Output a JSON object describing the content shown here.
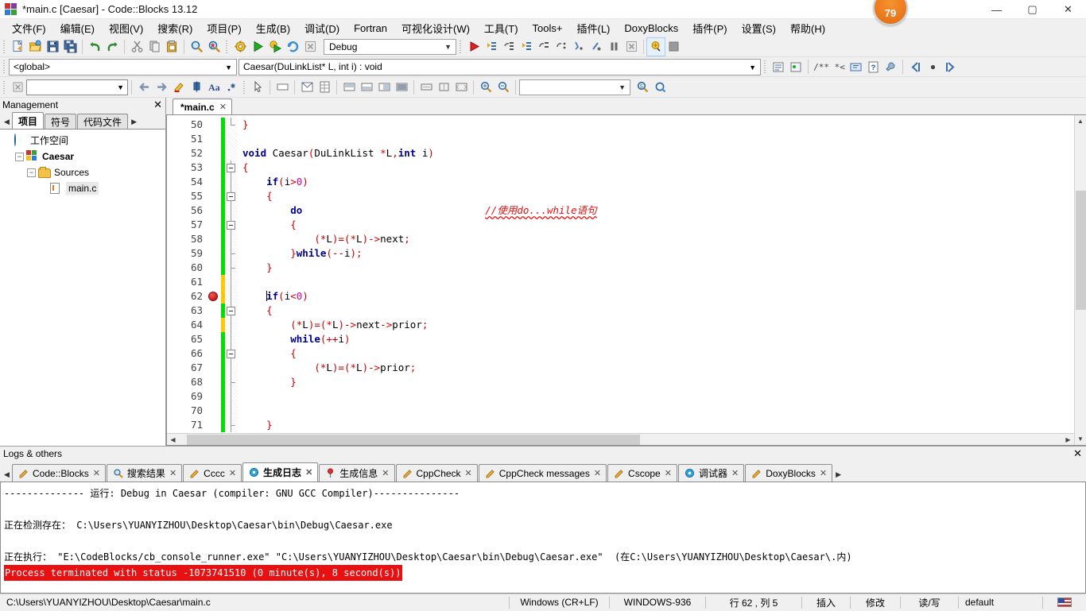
{
  "window": {
    "title": "*main.c [Caesar] - Code::Blocks 13.12",
    "logo": "codeblocks-logo-icon",
    "badge": "79",
    "minimize": "—",
    "maximize": "▢",
    "close": "✕"
  },
  "menubar": {
    "items": [
      {
        "label": "文件(F)",
        "name": "menu-file"
      },
      {
        "label": "编辑(E)",
        "name": "menu-edit"
      },
      {
        "label": "视图(V)",
        "name": "menu-view"
      },
      {
        "label": "搜索(R)",
        "name": "menu-search"
      },
      {
        "label": "项目(P)",
        "name": "menu-project"
      },
      {
        "label": "生成(B)",
        "name": "menu-build"
      },
      {
        "label": "调试(D)",
        "name": "menu-debug"
      },
      {
        "label": "Fortran",
        "name": "menu-fortran"
      },
      {
        "label": "可视化设计(W)",
        "name": "menu-wxsmith"
      },
      {
        "label": "工具(T)",
        "name": "menu-tools"
      },
      {
        "label": "Tools+",
        "name": "menu-tools-plus"
      },
      {
        "label": "插件(L)",
        "name": "menu-plugins-l"
      },
      {
        "label": "DoxyBlocks",
        "name": "menu-doxyblocks"
      },
      {
        "label": "插件(P)",
        "name": "menu-plugins-p"
      },
      {
        "label": "设置(S)",
        "name": "menu-settings"
      },
      {
        "label": "帮助(H)",
        "name": "menu-help"
      }
    ]
  },
  "toolbar_main": {
    "build_target": "Debug",
    "icons": [
      "new-file-icon",
      "open-file-icon",
      "save-icon",
      "save-all-icon",
      "undo-icon",
      "redo-icon",
      "cut-icon",
      "copy-icon",
      "paste-icon",
      "find-icon",
      "replace-icon"
    ],
    "compiler_icons": [
      "build-icon",
      "run-icon",
      "build-and-run-icon",
      "rebuild-icon",
      "abort-icon"
    ],
    "extra_icons": [
      "show-select-target-icon",
      "stop-icon"
    ],
    "debug_icons": [
      "debug-continue-icon",
      "run-to-cursor-icon",
      "next-line-icon",
      "step-into-icon",
      "step-out-icon",
      "next-instruction-icon",
      "step-into-instruction-icon",
      "break-debugger-icon",
      "pause-icon",
      "stop-debugger-icon",
      "debugging-windows-icon",
      "various-info-icon"
    ]
  },
  "scopebar": {
    "scope": "<global>",
    "function": "Caesar(DuLinkList* L, int i) : void"
  },
  "toolbar_secondary": {
    "search_value": "",
    "icons": [
      "code-completion-icon",
      "back-icon",
      "forward-icon",
      "highlight-icon",
      "bookmark-icon",
      "font-icon",
      "asterisk-icon",
      "pointer-icon",
      "panel-icon",
      "dialog-icon",
      "grid-icon",
      "align-left-icon",
      "align-bottom-icon",
      "align-right-icon",
      "fill-icon",
      "expand-h-icon",
      "expand-v-icon",
      "expand-both-icon",
      "zoom-in-icon",
      "zoom-out-icon",
      "select-icon",
      "search-s-icon",
      "search-c-icon"
    ],
    "combo_value": ""
  },
  "management": {
    "title": "Management",
    "close": "✕",
    "tabs": [
      {
        "label": "项目",
        "name": "tab-projects",
        "active": true
      },
      {
        "label": "符号",
        "name": "tab-symbols",
        "active": false
      },
      {
        "label": "代码文件",
        "name": "tab-files",
        "active": false
      }
    ],
    "tree": [
      {
        "label": "工作空间",
        "icon": "workspace-globe-icon",
        "indent": 0,
        "expander": ""
      },
      {
        "label": "Caesar",
        "icon": "project-icon",
        "indent": 1,
        "expander": "-"
      },
      {
        "label": "Sources",
        "icon": "folder-icon",
        "indent": 2,
        "expander": "-"
      },
      {
        "label": "main.c",
        "icon": "c-file-icon",
        "indent": 3,
        "expander": ""
      }
    ]
  },
  "editor": {
    "tab": {
      "label": "*main.c",
      "close": "✕"
    },
    "first_line": 50,
    "breakpoint_line": 62,
    "caret_line": 62,
    "lines": [
      {
        "n": 50,
        "mark": "green",
        "fold": "end",
        "code": "}"
      },
      {
        "n": 51,
        "mark": "green",
        "fold": "none",
        "code": ""
      },
      {
        "n": 52,
        "mark": "green",
        "fold": "none",
        "code": "void Caesar(DuLinkList *L,int i)"
      },
      {
        "n": 53,
        "mark": "green",
        "fold": "box",
        "code": "{"
      },
      {
        "n": 54,
        "mark": "green",
        "fold": "line",
        "code": "    if(i>0)"
      },
      {
        "n": 55,
        "mark": "green",
        "fold": "box",
        "code": "    {"
      },
      {
        "n": 56,
        "mark": "green",
        "fold": "line",
        "code": "        do"
      },
      {
        "n": 57,
        "mark": "green",
        "fold": "box",
        "code": "        {"
      },
      {
        "n": 58,
        "mark": "green",
        "fold": "line",
        "code": "            (*L)=(*L)->next;"
      },
      {
        "n": 59,
        "mark": "green",
        "fold": "tick",
        "code": "        }while(--i);"
      },
      {
        "n": 60,
        "mark": "green",
        "fold": "tick",
        "code": "    }"
      },
      {
        "n": 61,
        "mark": "yellow",
        "fold": "line",
        "code": ""
      },
      {
        "n": 62,
        "mark": "yellow",
        "fold": "line",
        "code": "    if(i<0)"
      },
      {
        "n": 63,
        "mark": "green",
        "fold": "box",
        "code": "    {"
      },
      {
        "n": 64,
        "mark": "yellow",
        "fold": "line",
        "code": "        (*L)=(*L)->next->prior;"
      },
      {
        "n": 65,
        "mark": "green",
        "fold": "line",
        "code": "        while(++i)"
      },
      {
        "n": 66,
        "mark": "green",
        "fold": "box",
        "code": "        {"
      },
      {
        "n": 67,
        "mark": "green",
        "fold": "line",
        "code": "            (*L)=(*L)->prior;"
      },
      {
        "n": 68,
        "mark": "green",
        "fold": "tick",
        "code": "        }"
      },
      {
        "n": 69,
        "mark": "green",
        "fold": "line",
        "code": ""
      },
      {
        "n": 70,
        "mark": "green",
        "fold": "line",
        "code": ""
      },
      {
        "n": 71,
        "mark": "green",
        "fold": "tick",
        "code": "    }"
      }
    ],
    "comment": {
      "text": "//使用do...while语句",
      "line": 56
    },
    "marker_colors": {
      "green": "#00e000",
      "yellow": "#ffc800",
      "breakpoint": "#cc1b1b"
    }
  },
  "logs": {
    "title": "Logs & others",
    "close": "✕",
    "tabs": [
      {
        "label": "Code::Blocks",
        "icon": "pencil-icon",
        "active": false
      },
      {
        "label": "搜索结果",
        "icon": "magnifier-icon",
        "active": false
      },
      {
        "label": "Cccc",
        "icon": "pencil-icon",
        "active": false
      },
      {
        "label": "生成日志",
        "icon": "gear-blue-icon",
        "active": true
      },
      {
        "label": "生成信息",
        "icon": "pin-icon",
        "active": false
      },
      {
        "label": "CppCheck",
        "icon": "pencil-icon",
        "active": false
      },
      {
        "label": "CppCheck messages",
        "icon": "pencil-icon",
        "active": false
      },
      {
        "label": "Cscope",
        "icon": "pencil-icon",
        "active": false
      },
      {
        "label": "调试器",
        "icon": "gear-blue-icon",
        "active": false
      },
      {
        "label": "DoxyBlocks",
        "icon": "pencil-icon",
        "active": false
      }
    ],
    "lines": [
      {
        "text": "-------------- 运行: Debug in Caesar (compiler: GNU GCC Compiler)---------------",
        "style": "normal"
      },
      {
        "text": "",
        "style": "normal"
      },
      {
        "text": "正在检测存在： C:\\Users\\YUANYIZHOU\\Desktop\\Caesar\\bin\\Debug\\Caesar.exe",
        "style": "normal"
      },
      {
        "text": "",
        "style": "normal"
      },
      {
        "text": "正在执行： \"E:\\CodeBlocks/cb_console_runner.exe\" \"C:\\Users\\YUANYIZHOU\\Desktop\\Caesar\\bin\\Debug\\Caesar.exe\"  (在C:\\Users\\YUANYIZHOU\\Desktop\\Caesar\\.内)",
        "style": "normal"
      },
      {
        "text": "Process terminated with status -1073741510 (0 minute(s), 8 second(s))",
        "style": "error"
      }
    ]
  },
  "statusbar": {
    "path": "C:\\Users\\YUANYIZHOU\\Desktop\\Caesar\\main.c",
    "eol": "Windows (CR+LF)",
    "encoding": "WINDOWS-936",
    "position": "行 62 , 列 5",
    "insert_mode": "插入",
    "modified": "修改",
    "readwrite": "读/写",
    "profile": "default",
    "flag": "us-flag-icon"
  }
}
